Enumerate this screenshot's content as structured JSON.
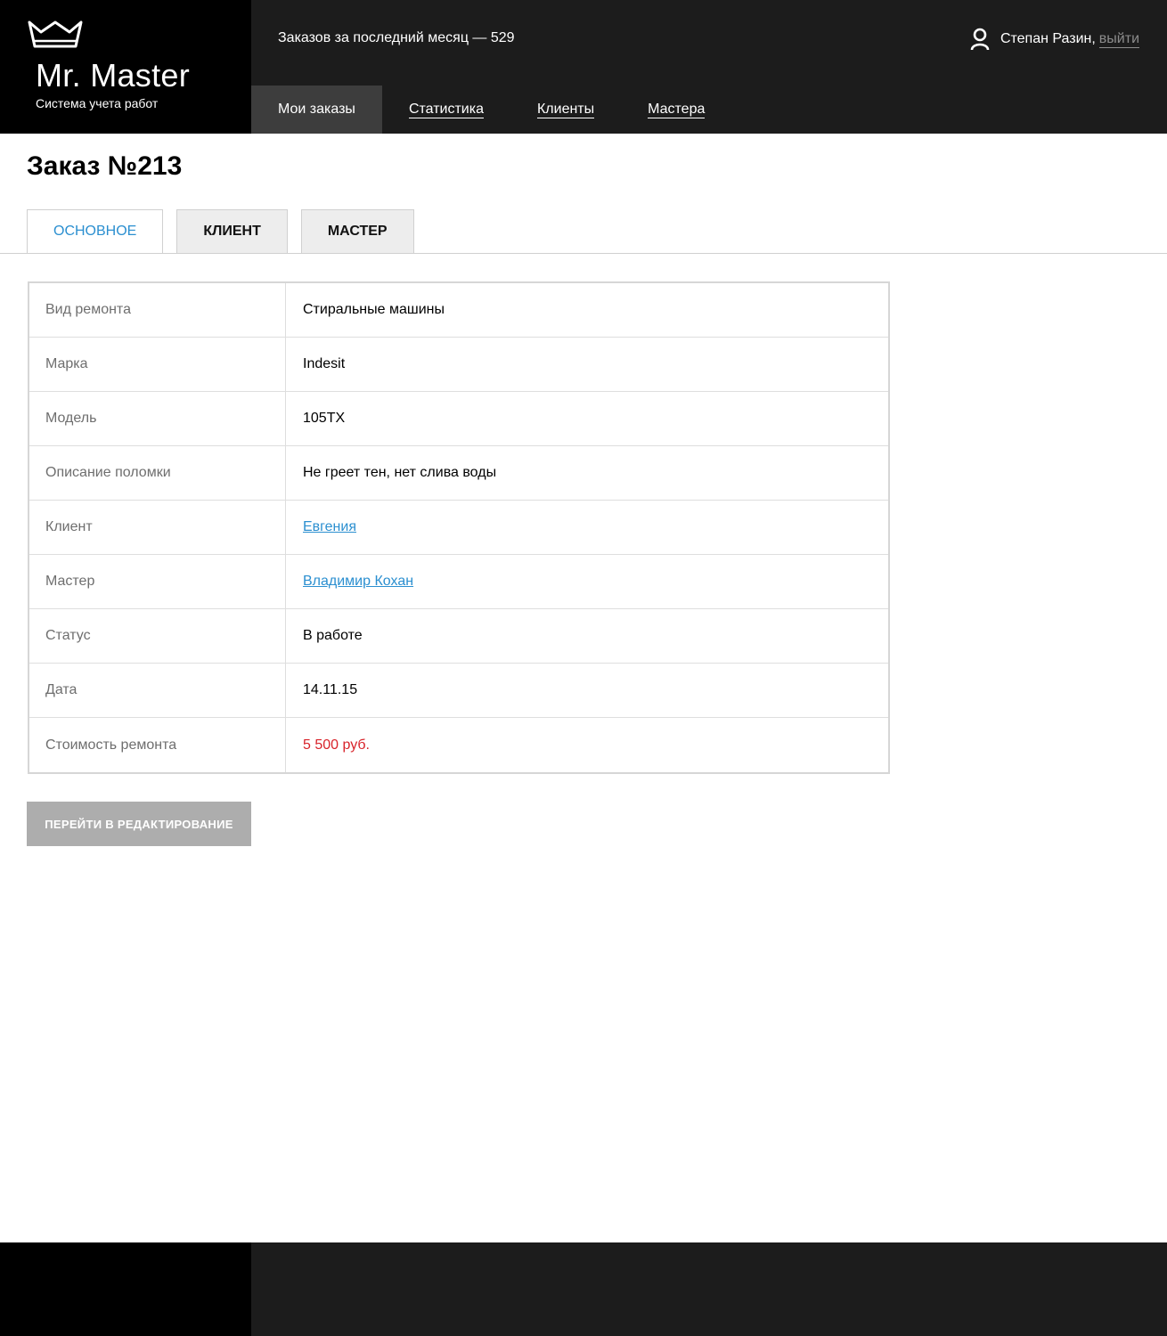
{
  "brand": {
    "name": "Mr. Master",
    "tagline": "Система учета работ"
  },
  "header": {
    "orders_count_text": "Заказов за последний месяц — 529",
    "user_name": "Степан Разин,",
    "logout_label": "выйти"
  },
  "nav": {
    "items": [
      {
        "label": "Мои заказы",
        "active": true
      },
      {
        "label": "Статистика"
      },
      {
        "label": "Клиенты"
      },
      {
        "label": "Мастера"
      }
    ]
  },
  "page": {
    "title": "Заказ №213"
  },
  "tabs": [
    {
      "label": "Основное",
      "active": true
    },
    {
      "label": "Клиент"
    },
    {
      "label": "Мастер"
    }
  ],
  "details": {
    "rows": [
      {
        "label": "Вид ремонта",
        "value": "Стиральные машины"
      },
      {
        "label": "Марка",
        "value": "Indesit"
      },
      {
        "label": "Модель",
        "value": "105TX"
      },
      {
        "label": "Описание поломки",
        "value": "Не греет тен, нет слива воды"
      },
      {
        "label": "Клиент",
        "value": "Евгения"
      },
      {
        "label": "Мастер",
        "value": "Владимир Кохан"
      },
      {
        "label": "Статус",
        "value": "В работе"
      },
      {
        "label": "Дата",
        "value": "14.11.15"
      },
      {
        "label": "Стоимость ремонта",
        "value": "5 500 руб."
      }
    ]
  },
  "actions": {
    "edit_label": "Перейти в редактирование"
  },
  "colors": {
    "header_bg": "#1c1c1c",
    "logo_bg": "#000000",
    "active_nav_bg": "#3d3d3d",
    "link": "#2b8fd0",
    "price": "#d8232a",
    "button_bg": "#adadad"
  },
  "icons": {
    "logo": "crown-basin-icon",
    "user": "user-icon"
  }
}
